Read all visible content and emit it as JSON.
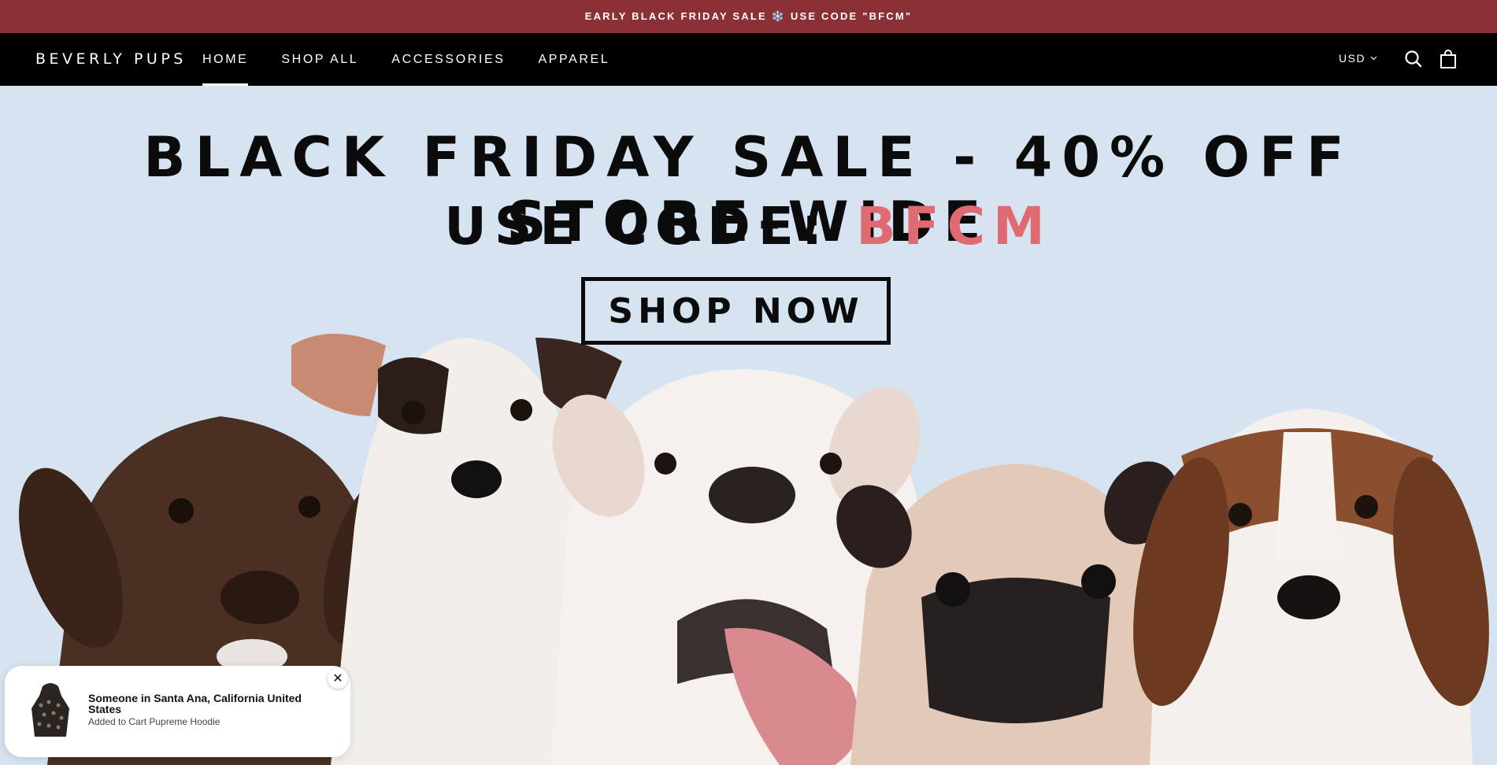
{
  "announcement": {
    "text": "EARLY BLACK FRIDAY SALE ❄️ USE CODE \"BFCM\""
  },
  "header": {
    "logo": "BEVERLY PUPS",
    "nav": [
      {
        "label": "HOME",
        "active": true
      },
      {
        "label": "SHOP ALL",
        "active": false
      },
      {
        "label": "ACCESSORIES",
        "active": false
      },
      {
        "label": "APPAREL",
        "active": false
      }
    ],
    "currency": "USD",
    "icons": {
      "search": "search-icon",
      "cart": "shopping-bag-icon"
    }
  },
  "hero": {
    "headline": "BLACK FRIDAY SALE - 40% OFF STORE-WIDE",
    "code_prefix": "USE CODE: ",
    "code": "BFCM",
    "cta": "SHOP NOW"
  },
  "toast": {
    "title": "Someone in Santa Ana, California United States",
    "subtitle": "Added to Cart Pupreme Hoodie",
    "close": "✕"
  },
  "colors": {
    "announcement_bg": "#8b3036",
    "nav_bg": "#000000",
    "hero_bg": "#d6e3f0",
    "code_accent": "#df6a72"
  }
}
